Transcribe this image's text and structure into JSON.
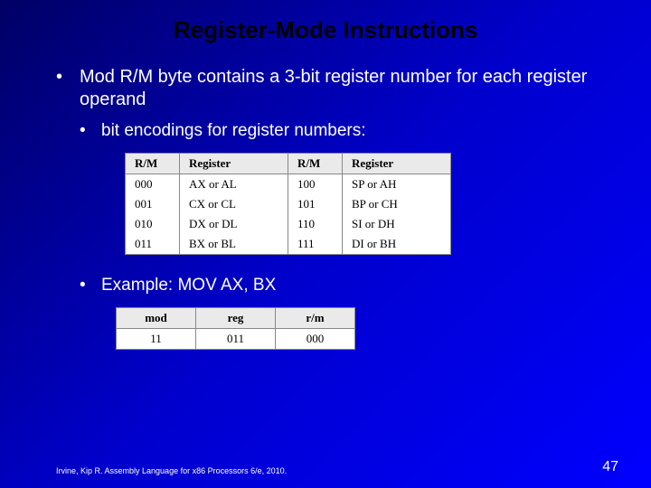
{
  "title": "Register-Mode Instructions",
  "bullets": {
    "b1": "Mod R/M byte contains a 3-bit register number for each register operand",
    "b2": "bit encodings for register numbers:",
    "b3": "Example: MOV AX, BX"
  },
  "reg_table": {
    "headers": {
      "rm": "R/M",
      "reg": "Register"
    },
    "rows": [
      {
        "rm1": "000",
        "reg1": "AX or AL",
        "rm2": "100",
        "reg2": "SP or AH"
      },
      {
        "rm1": "001",
        "reg1": "CX or CL",
        "rm2": "101",
        "reg2": "BP or CH"
      },
      {
        "rm1": "010",
        "reg1": "DX or DL",
        "rm2": "110",
        "reg2": "SI or DH"
      },
      {
        "rm1": "011",
        "reg1": "BX or BL",
        "rm2": "111",
        "reg2": "DI or BH"
      }
    ]
  },
  "ex_table": {
    "headers": {
      "mod": "mod",
      "reg": "reg",
      "rm": "r/m"
    },
    "row": {
      "mod": "11",
      "reg": "011",
      "rm": "000"
    }
  },
  "footer": {
    "cite": "Irvine, Kip R. Assembly Language for x86 Processors 6/e, 2010.",
    "page": "47"
  }
}
